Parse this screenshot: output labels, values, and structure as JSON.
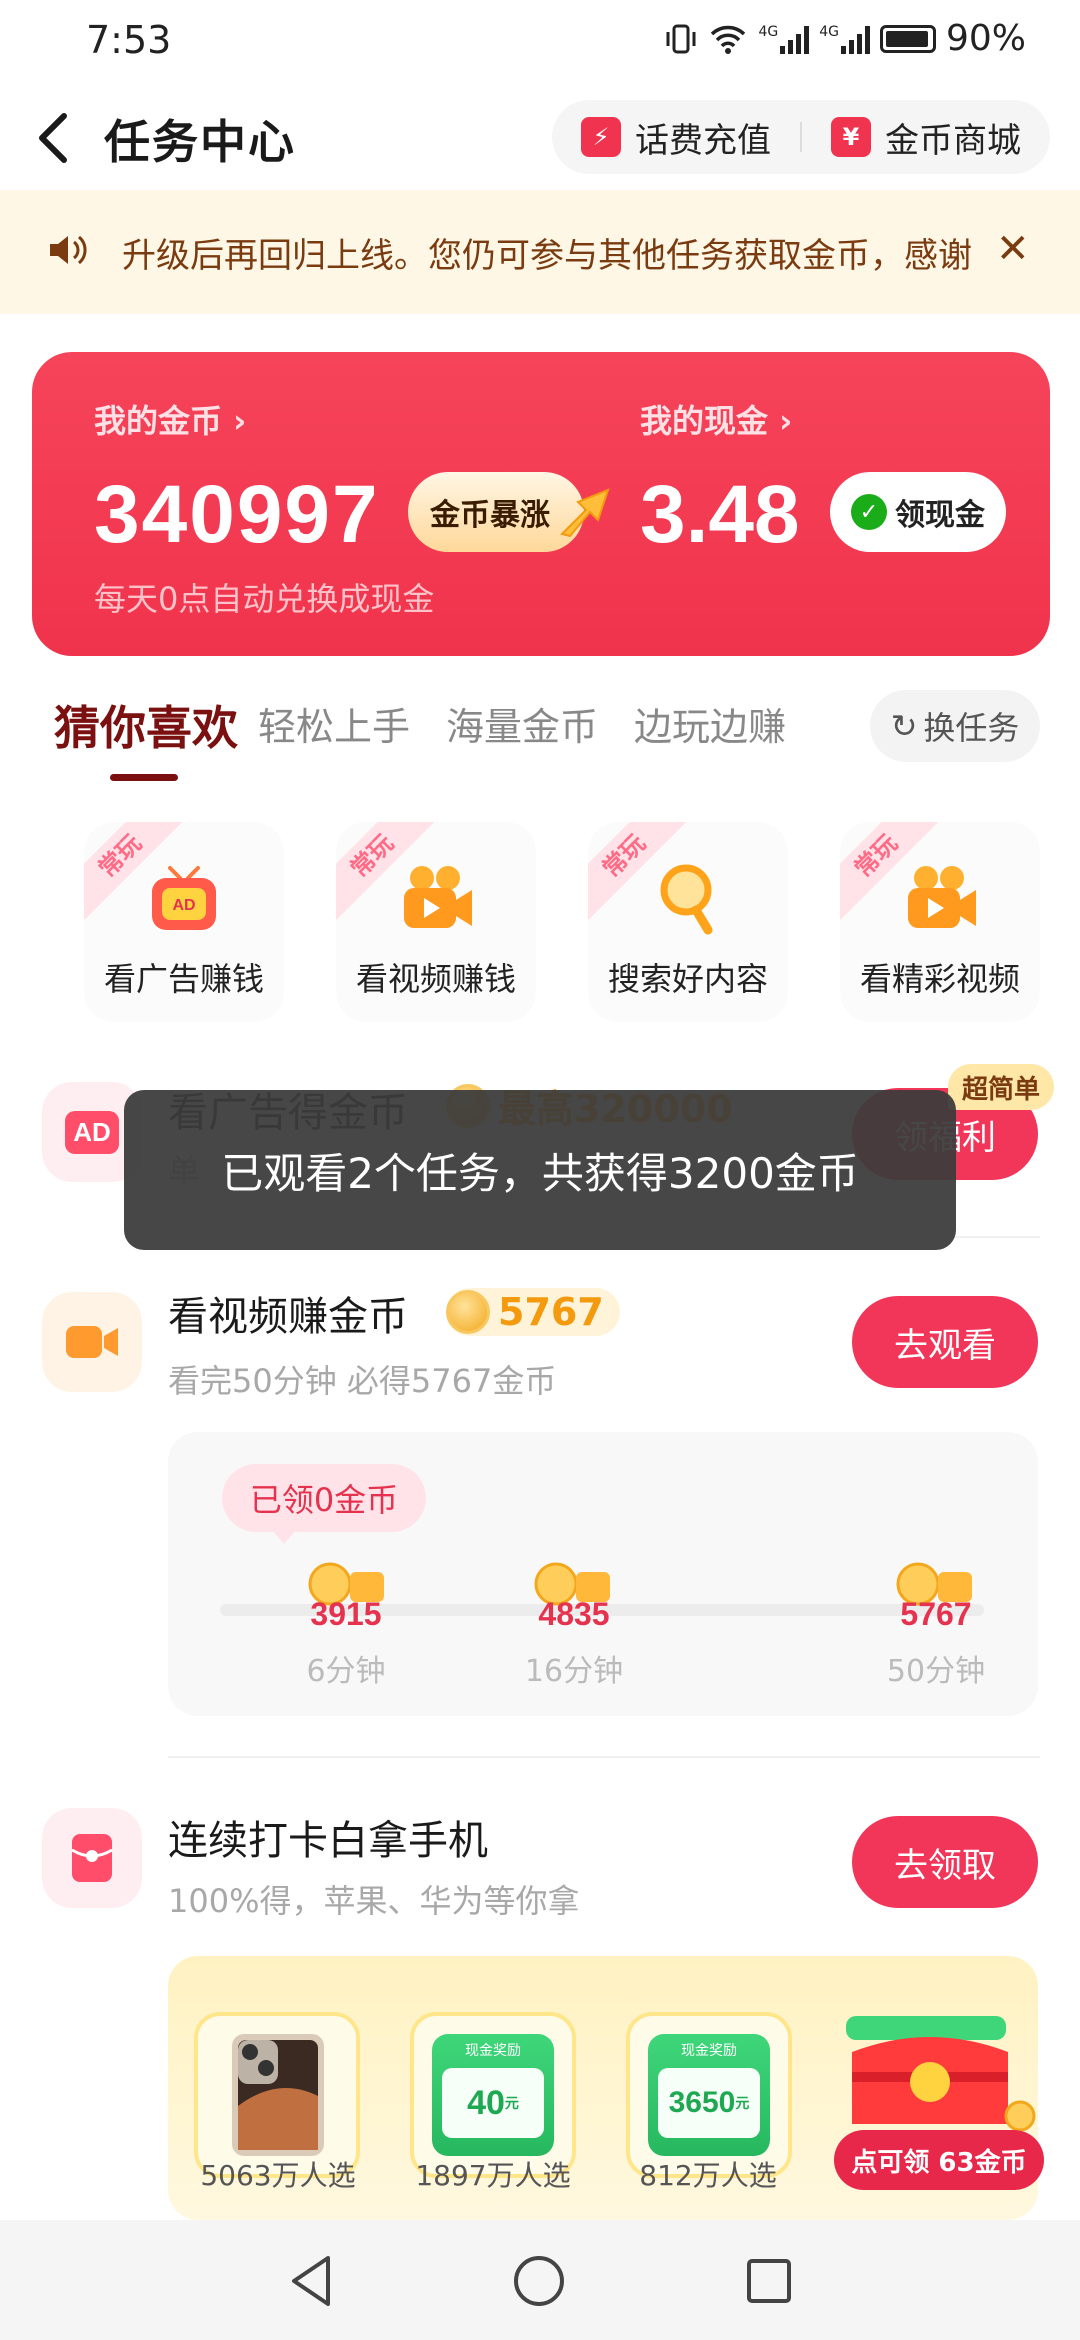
{
  "status_bar": {
    "time": "7:53",
    "network_1": "4G",
    "network_2": "4G",
    "battery": "90%"
  },
  "header": {
    "title": "任务中心",
    "topup_label": "话费充值",
    "topup_icon_glyph": "⚡",
    "mall_label": "金币商城",
    "mall_icon_glyph": "¥"
  },
  "notice": {
    "text": "升级后再回归上线。您仍可参与其他任务获取金币，感谢",
    "close_glyph": "✕"
  },
  "wallet": {
    "coins_label": "我的金币 ›",
    "coins_value": "340997",
    "coin_boost_label": "金币暴涨",
    "cash_label": "我的现金 ›",
    "cash_value": "3.48",
    "cash_button_label": "领现金",
    "cash_button_icon": "✓",
    "subtitle": "每天0点自动兑换成现金"
  },
  "tabs": [
    {
      "label": "猜你喜欢",
      "active": true
    },
    {
      "label": "轻松上手",
      "active": false
    },
    {
      "label": "海量金币",
      "active": false
    },
    {
      "label": "边玩边赚",
      "active": false
    }
  ],
  "swap_button": {
    "icon": "↻",
    "label": "换任务"
  },
  "categories": [
    {
      "tag": "常玩",
      "label": "看广告赚钱",
      "icon": "tv-ad-icon"
    },
    {
      "tag": "常玩",
      "label": "看视频赚钱",
      "icon": "video-camera-icon"
    },
    {
      "tag": "常玩",
      "label": "搜索好内容",
      "icon": "magnifier-icon"
    },
    {
      "tag": "常玩",
      "label": "看精彩视频",
      "icon": "video-camera-icon"
    }
  ],
  "tasks": {
    "ad": {
      "icon_text": "AD",
      "title": "看广告得金币",
      "badge": "最高320000",
      "sub": "单",
      "button": "领福利",
      "corner_badge": "超简单"
    },
    "video": {
      "title": "看视频赚金币",
      "badge": "5767",
      "sub": "看完50分钟 必得5767金币",
      "button": "去观看"
    },
    "checkin": {
      "title": "连续打卡白拿手机",
      "sub": "100%得，苹果、华为等你拿",
      "button": "去领取"
    }
  },
  "video_progress": {
    "claimed": "已领0金币",
    "milestones": [
      {
        "amount": "3915",
        "time": "6分钟"
      },
      {
        "amount": "4835",
        "time": "16分钟"
      },
      {
        "amount": "5767",
        "time": "50分钟"
      }
    ]
  },
  "prizes": [
    {
      "kind": "phone",
      "caption": "5063万人选"
    },
    {
      "kind": "cash",
      "card_title": "现金奖励",
      "amount": "40",
      "unit": "元",
      "caption": "1897万人选"
    },
    {
      "kind": "cash",
      "card_title": "现金奖励",
      "amount": "3650",
      "unit": "元",
      "caption": "812万人选"
    },
    {
      "kind": "chest",
      "caption": ""
    }
  ],
  "claim_pill": "点可领 63金币",
  "toast": "已观看2个任务，共获得3200金币",
  "colors": {
    "primary_red": "#f2365a",
    "card_red": "#f0334c",
    "notice_bg": "#fff7e6",
    "tab_active": "#7a1010",
    "coin_gold": "#f39a0e"
  }
}
